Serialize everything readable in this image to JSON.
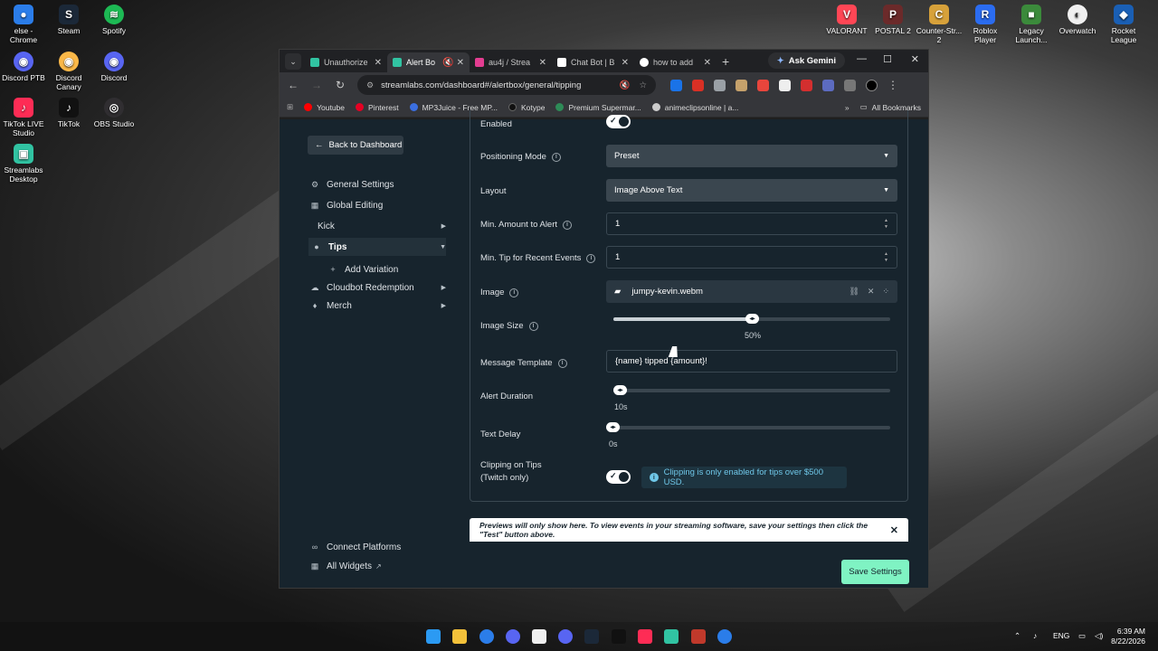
{
  "desktop": {
    "left_icons": [
      {
        "label": "else - Chrome",
        "color": "#2b7de9"
      },
      {
        "label": "Steam",
        "color": "#1b2838"
      },
      {
        "label": "Spotify",
        "color": "#1db954"
      },
      {
        "label": "Discord PTB",
        "color": "#5865f2"
      },
      {
        "label": "Discord Canary",
        "color": "#fbb848"
      },
      {
        "label": "Discord",
        "color": "#5865f2"
      },
      {
        "label": "TikTok LIVE Studio",
        "color": "#fe2c55"
      },
      {
        "label": "TikTok",
        "color": "#111111"
      },
      {
        "label": "OBS Studio",
        "color": "#302e31"
      },
      {
        "label": "Streamlabs Desktop",
        "color": "#31c3a2"
      }
    ],
    "right_icons": [
      {
        "label": "VALORANT",
        "color": "#ff4655"
      },
      {
        "label": "POSTAL 2",
        "color": "#6b2a2a"
      },
      {
        "label": "Counter-Str... 2",
        "color": "#d7a13a"
      },
      {
        "label": "Roblox Player",
        "color": "#2b6cf0"
      },
      {
        "label": "Legacy Launch...",
        "color": "#3b8a3b"
      },
      {
        "label": "Overwatch",
        "color": "#f0f0f0"
      },
      {
        "label": "Rocket League",
        "color": "#1a5fb4"
      }
    ]
  },
  "browser": {
    "tabs": [
      {
        "label": "Unauthorize",
        "color": "#31c3a2",
        "active": false
      },
      {
        "label": "Alert Bo",
        "color": "#31c3a2",
        "active": true
      },
      {
        "label": "au4j / Strea",
        "color": "#e33d91",
        "active": false
      },
      {
        "label": "Chat Bot | B",
        "color": "#ffffff",
        "active": false
      },
      {
        "label": "how to add",
        "color": "#ffffff",
        "active": false
      }
    ],
    "ask_gemini": "Ask Gemini",
    "url": "streamlabs.com/dashboard#/alertbox/general/tipping",
    "bookmarks": [
      {
        "label": "Youtube",
        "color": "#ff0000"
      },
      {
        "label": "Pinterest",
        "color": "#e60023"
      },
      {
        "label": "MP3Juice - Free MP...",
        "color": "#3b6fe0"
      },
      {
        "label": "Kotype",
        "color": "#111111"
      },
      {
        "label": "Premium Supermar...",
        "color": "#2e8b57"
      },
      {
        "label": "animeclipsonline | a...",
        "color": "#cccccc"
      }
    ],
    "all_bookmarks": "All Bookmarks"
  },
  "sidebar": {
    "back": "Back to Dashboard",
    "items": [
      {
        "label": "General Settings",
        "icon": "gear-icon"
      },
      {
        "label": "Global Editing",
        "icon": "grid-icon"
      },
      {
        "label": "Kick",
        "icon": ""
      },
      {
        "label": "Tips",
        "icon": "tip-icon"
      },
      {
        "label": "Add Variation",
        "icon": "plus-icon"
      },
      {
        "label": "Cloudbot Redemption",
        "icon": "bot-icon"
      },
      {
        "label": "Merch",
        "icon": "shirt-icon"
      }
    ],
    "connect": "Connect Platforms",
    "all_widgets": "All Widgets"
  },
  "form": {
    "enabled_label": "Enabled",
    "positioning_label": "Positioning Mode",
    "positioning_value": "Preset",
    "layout_label": "Layout",
    "layout_value": "Image Above Text",
    "min_amount_label": "Min. Amount to Alert",
    "min_amount_value": "1",
    "min_tip_label": "Min. Tip for Recent Events",
    "min_tip_value": "1",
    "image_label": "Image",
    "image_value": "jumpy-kevin.webm",
    "image_size_label": "Image Size",
    "image_size_value": "50%",
    "image_size_fraction": 0.5,
    "message_label": "Message Template",
    "message_value": "{name} tipped {amount}!",
    "duration_label": "Alert Duration",
    "duration_value": "10s",
    "text_delay_label": "Text Delay",
    "text_delay_value": "0s",
    "clipping_label_1": "Clipping on Tips",
    "clipping_label_2": "(Twitch only)",
    "clipping_notice": "Clipping is only enabled for tips over $500 USD."
  },
  "preview_notice": "Previews will only show here. To view events in your streaming software, save your settings then click the \"Test\" button above.",
  "save_label": "Save Settings",
  "taskbar": {
    "lang": "ENG",
    "time": "6:39 AM",
    "date": "8/22/2026"
  }
}
